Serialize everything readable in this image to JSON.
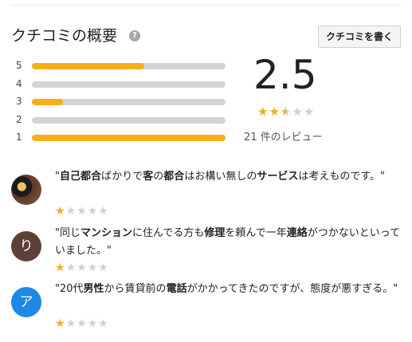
{
  "header": {
    "title": "クチコミの概要",
    "help_icon": "question-circle-icon",
    "write_review_label": "クチコミを書く"
  },
  "summary": {
    "average": "2.5",
    "average_value": 2.5,
    "max_stars": 5,
    "review_count_text": "21 件のレビュー",
    "distribution": [
      {
        "label": "5",
        "fraction": 0.58
      },
      {
        "label": "4",
        "fraction": 0
      },
      {
        "label": "3",
        "fraction": 0.16
      },
      {
        "label": "2",
        "fraction": 0
      },
      {
        "label": "1",
        "fraction": 1.0
      }
    ]
  },
  "colors": {
    "star_filled": "#f7ae1b",
    "star_empty": "#d0d0d0",
    "bar_fill": "#f7ae1b",
    "bar_track": "#d4d4d4"
  },
  "reviews": [
    {
      "avatar_type": "photo",
      "avatar_letter": "",
      "avatar_color": "#5a3a28",
      "text_parts": [
        {
          "t": "\"",
          "b": false
        },
        {
          "t": "自己都合",
          "b": true
        },
        {
          "t": "ばかりで",
          "b": false
        },
        {
          "t": "客",
          "b": true
        },
        {
          "t": "の",
          "b": false
        },
        {
          "t": "都合",
          "b": true
        },
        {
          "t": "はお構い無しの",
          "b": false
        },
        {
          "t": "サービス",
          "b": true
        },
        {
          "t": "は考えものです。\"",
          "b": false
        }
      ],
      "rating": 1
    },
    {
      "avatar_type": "letter",
      "avatar_letter": "り",
      "avatar_color": "#5d4037",
      "text_parts": [
        {
          "t": "\"同じ",
          "b": false
        },
        {
          "t": "マンション",
          "b": true
        },
        {
          "t": "に住んでる方も",
          "b": false
        },
        {
          "t": "修理",
          "b": true
        },
        {
          "t": "を頼んで一年",
          "b": false
        },
        {
          "t": "連絡",
          "b": true
        },
        {
          "t": "がつかないといっていました。\"",
          "b": false
        }
      ],
      "rating": 1
    },
    {
      "avatar_type": "letter",
      "avatar_letter": "ア",
      "avatar_color": "#1e88e5",
      "text_parts": [
        {
          "t": "\"20代",
          "b": false
        },
        {
          "t": "男性",
          "b": true
        },
        {
          "t": "から賃貸前の",
          "b": false
        },
        {
          "t": "電話",
          "b": true
        },
        {
          "t": "がかかってきたのですが、態度が悪すぎる。\"",
          "b": false
        }
      ],
      "rating": 1
    }
  ]
}
